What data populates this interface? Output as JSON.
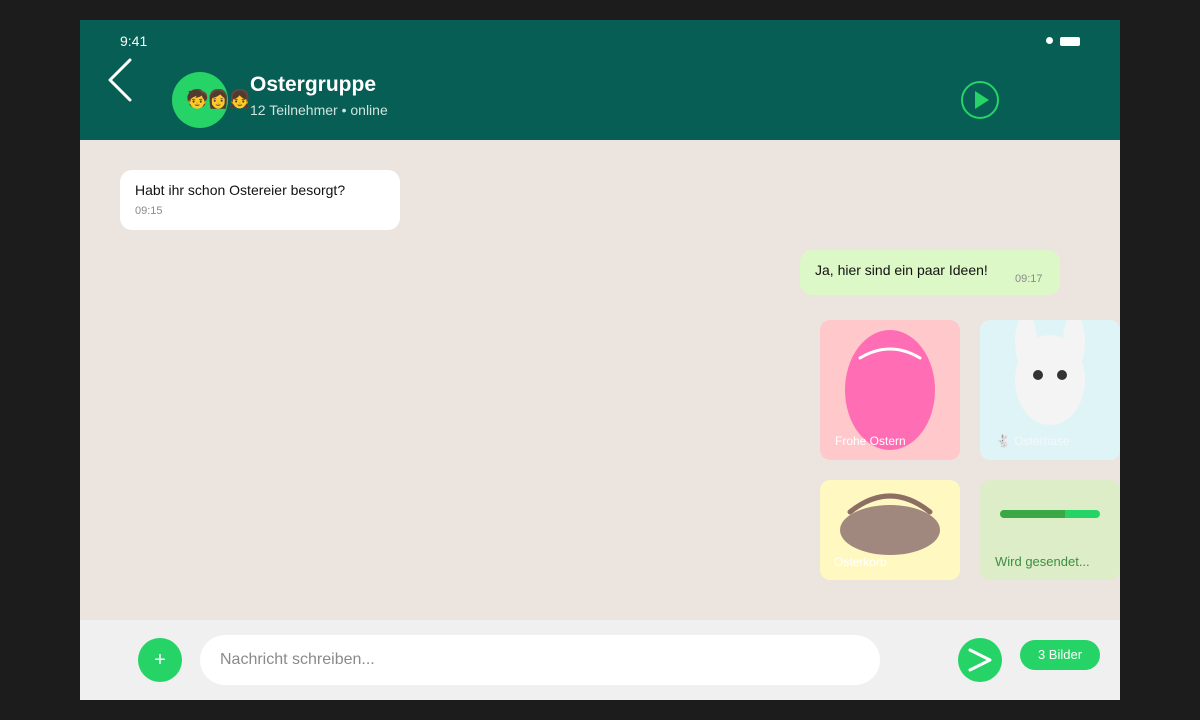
{
  "status_bar": {
    "time": "9:41"
  },
  "chat": {
    "title": "Ostergruppe",
    "subtitle": "12 Teilnehmer • online",
    "avatar_emoji": "🧒👩👧"
  },
  "messages": [
    {
      "direction": "incoming",
      "text": "Habt ihr schon Ostereier besorgt?",
      "time": "09:15"
    },
    {
      "direction": "outgoing",
      "text": "Ja, hier sind ein paar Ideen!",
      "time": "09:17"
    }
  ],
  "images": [
    {
      "label": "Frohe Ostern"
    },
    {
      "label": "🐇 Osterhase"
    },
    {
      "label": "Osterkorb"
    },
    {
      "label": "Wird gesendet...",
      "progress": 0.65
    }
  ],
  "composer": {
    "plus_label": "+",
    "placeholder": "Nachricht schreiben...",
    "badge_label": "3 Bilder"
  },
  "colors": {
    "header": "#075e54",
    "accent": "#25d366",
    "chat_background": "#ece5df",
    "outgoing_bubble": "#dcf8c6"
  },
  "icons": {
    "back": "chevron-left-icon",
    "play": "play-icon",
    "send": "send-icon"
  }
}
